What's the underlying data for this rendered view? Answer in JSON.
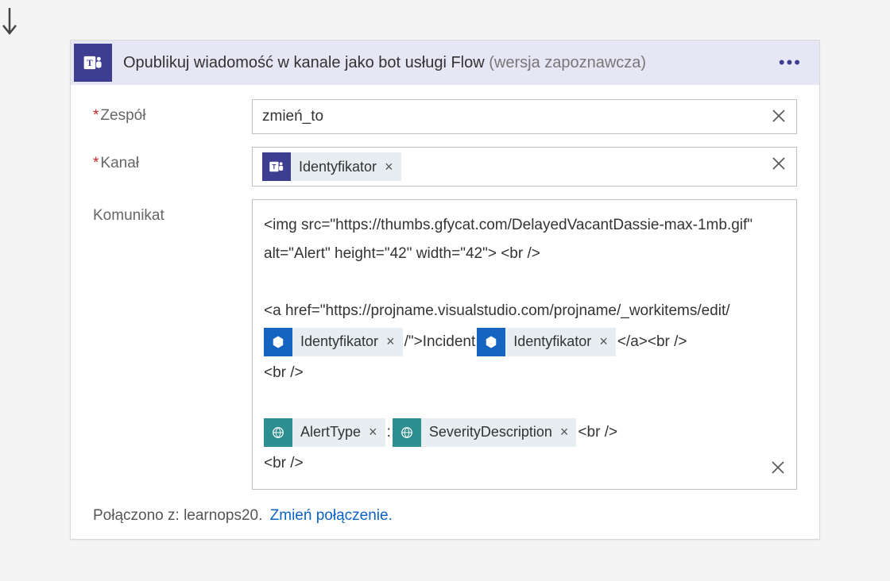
{
  "card": {
    "title": "Opublikuj wiadomość w kanale jako bot usługi Flow",
    "subtitle": "(wersja zapoznawcza)"
  },
  "labels": {
    "team": "Zespół",
    "channel": "Kanał",
    "message": "Komunikat"
  },
  "fields": {
    "team_value": "zmień_to",
    "channel_token": "Identyfikator"
  },
  "message": {
    "line1": "<img src=\"https://thumbs.gfycat.com/DelayedVacantDassie-max-1mb.gif\" alt=\"Alert\" height=\"42\" width=\"42\"> <br />",
    "blank": " ",
    "line3a": "<a href=\"https://projname.visualstudio.com/projname/_workitems/edit/",
    "token_id1": "Identyfikator",
    "line3b": "/\">Incident",
    "token_id2": "Identyfikator",
    "line3c": "</a><br />",
    "line4": "<br />",
    "token_alert": "AlertType",
    "sep": ":",
    "token_sev": "SeverityDescription",
    "line5b": "<br />",
    "line6": "<br />"
  },
  "connection": {
    "text": "Połączono z: learnops20.",
    "link": "Zmień połączenie."
  }
}
